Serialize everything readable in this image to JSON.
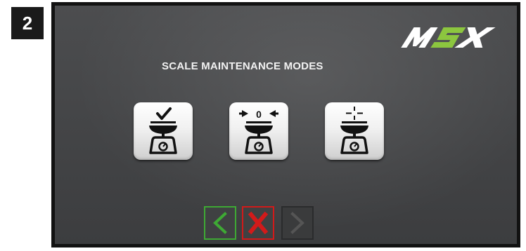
{
  "step_badge": "2",
  "logo": {
    "text": "MSX",
    "accent_color": "#8cc63f"
  },
  "screen": {
    "title": "SCALE MAINTENANCE MODES"
  },
  "modes": [
    {
      "icon": "scale-check-icon"
    },
    {
      "icon": "scale-zero-icon",
      "label": "0"
    },
    {
      "icon": "scale-crosshair-icon"
    }
  ],
  "nav": {
    "back": {
      "icon": "chevron-left-icon",
      "color": "#3ea934"
    },
    "cancel": {
      "icon": "x-icon",
      "color": "#d21a1a"
    },
    "next": {
      "icon": "chevron-right-icon",
      "color": "#555555"
    }
  }
}
